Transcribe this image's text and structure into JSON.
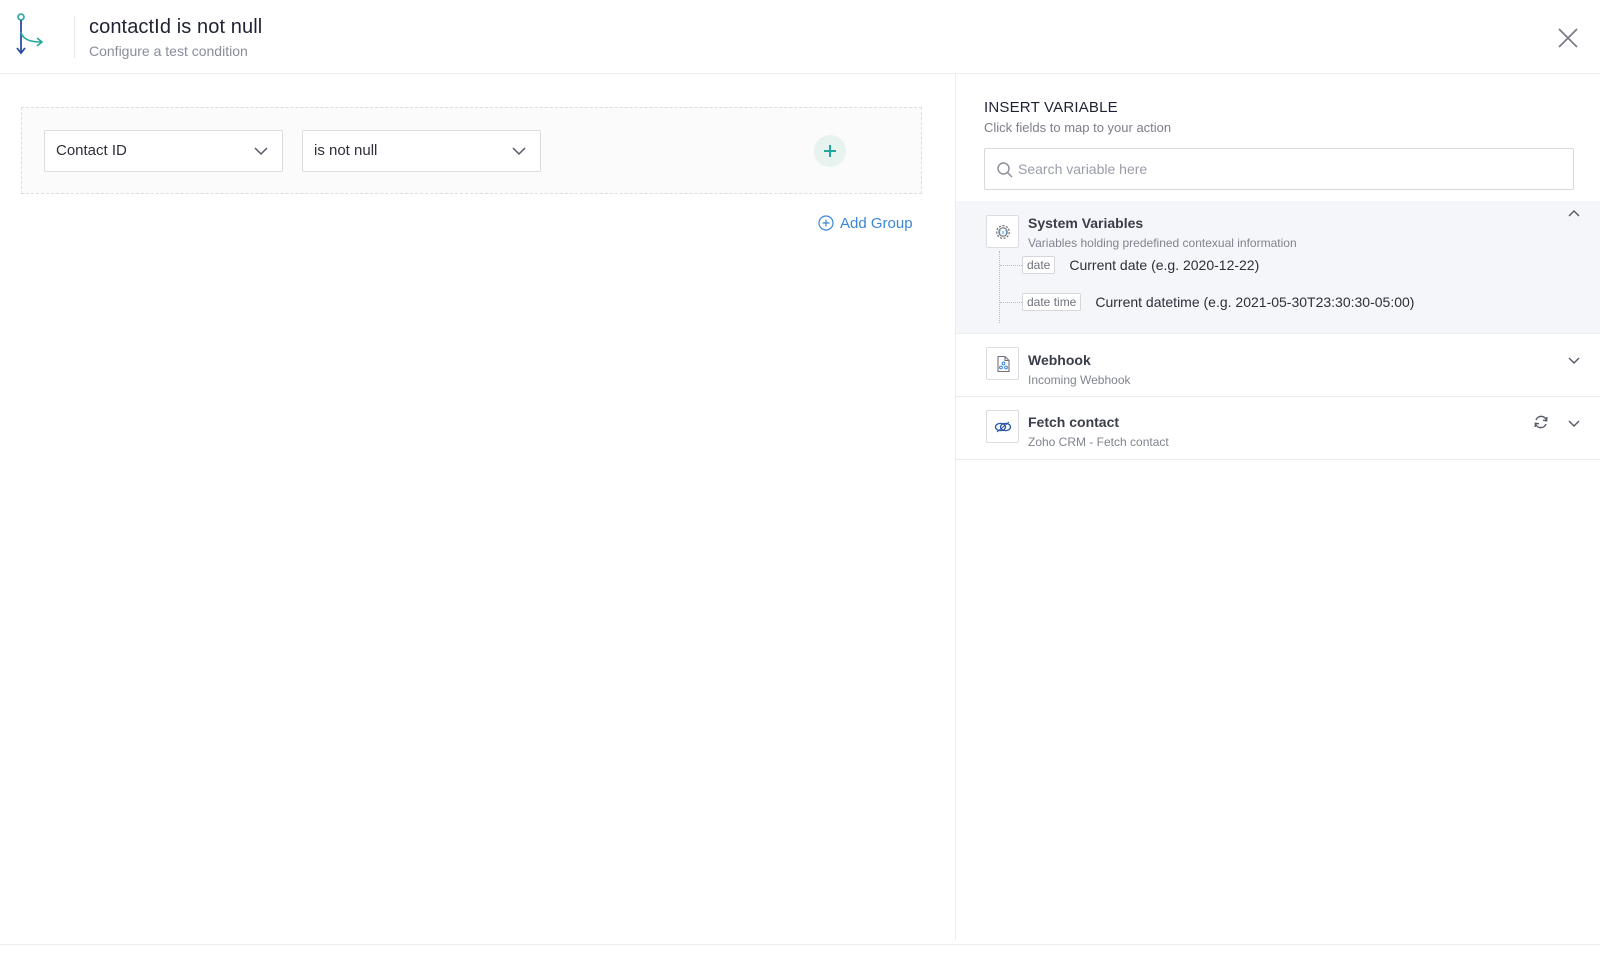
{
  "header": {
    "title": "contactId is not null",
    "subtitle": "Configure a test condition",
    "colors": {
      "logo_teal": "#22a89a",
      "logo_blue": "#2b4fa0"
    }
  },
  "condition": {
    "field_value": "Contact ID",
    "operator_value": "is not null",
    "add_group_label": "Add Group",
    "accent_color": "#3a86d8",
    "add_button_bg": "#e6f3ef",
    "add_button_color": "#22a89a"
  },
  "insert_variable": {
    "title": "INSERT VARIABLE",
    "subtitle": "Click fields to map to your action",
    "search_placeholder": "Search variable here",
    "groups": [
      {
        "title": "System Variables",
        "subtitle": "Variables holding predefined contexual information",
        "icon": "gear-variable-icon",
        "expanded": true,
        "variables": [
          {
            "tag": "date",
            "description": "Current date (e.g. 2020-12-22)"
          },
          {
            "tag": "date time",
            "description": "Current datetime (e.g. 2021-05-30T23:30:30-05:00)"
          }
        ]
      },
      {
        "title": "Webhook",
        "subtitle": "Incoming Webhook",
        "icon": "webhook-file-icon",
        "expanded": false
      },
      {
        "title": "Fetch contact",
        "subtitle": "Zoho CRM - Fetch contact",
        "icon": "link-icon",
        "expanded": false
      }
    ]
  }
}
